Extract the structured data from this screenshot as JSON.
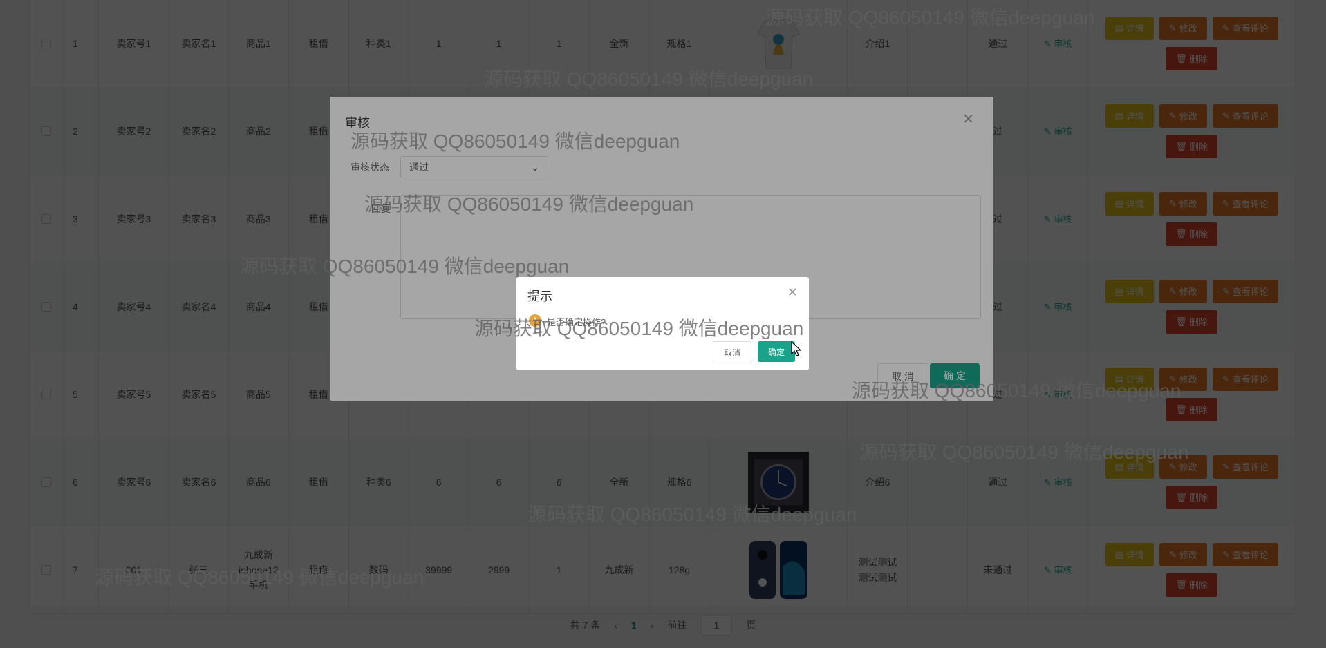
{
  "rows": [
    {
      "no": "1",
      "seller_no": "卖家号1",
      "seller_name": "卖家名1",
      "goods": "商品1",
      "mode": "租借",
      "category": "种类1",
      "c1": "1",
      "c2": "1",
      "c3": "1",
      "condition": "全新",
      "spec": "规格1",
      "intro": "介绍1",
      "status": "通过",
      "img": "tshirt"
    },
    {
      "no": "2",
      "seller_no": "卖家号2",
      "seller_name": "卖家名2",
      "goods": "商品2",
      "mode": "租借",
      "category": "",
      "c1": "",
      "c2": "",
      "c3": "",
      "condition": "",
      "spec": "",
      "intro": "",
      "status": "过",
      "img": ""
    },
    {
      "no": "3",
      "seller_no": "卖家号3",
      "seller_name": "卖家名3",
      "goods": "商品3",
      "mode": "租借",
      "category": "",
      "c1": "",
      "c2": "",
      "c3": "",
      "condition": "",
      "spec": "",
      "intro": "",
      "status": "过",
      "img": ""
    },
    {
      "no": "4",
      "seller_no": "卖家号4",
      "seller_name": "卖家名4",
      "goods": "商品4",
      "mode": "租借",
      "category": "",
      "c1": "",
      "c2": "",
      "c3": "",
      "condition": "",
      "spec": "",
      "intro": "",
      "status": "过",
      "img": ""
    },
    {
      "no": "5",
      "seller_no": "卖家号5",
      "seller_name": "卖家名5",
      "goods": "商品5",
      "mode": "租借",
      "category": "",
      "c1": "",
      "c2": "",
      "c3": "",
      "condition": "",
      "spec": "",
      "intro": "",
      "status": "过",
      "img": ""
    },
    {
      "no": "6",
      "seller_no": "卖家号6",
      "seller_name": "卖家名6",
      "goods": "商品6",
      "mode": "租借",
      "category": "种类6",
      "c1": "6",
      "c2": "6",
      "c3": "6",
      "condition": "全新",
      "spec": "规格6",
      "intro": "介绍6",
      "status": "通过",
      "img": "watch"
    },
    {
      "no": "7",
      "seller_no": "001",
      "seller_name": "张三",
      "goods": "九成新iphone12手机",
      "mode": "租借",
      "category": "数码",
      "c1": "39999",
      "c2": "2999",
      "c3": "1",
      "condition": "九成新",
      "spec": "128g",
      "intro": "测试测试测试测试",
      "status": "未通过",
      "img": "phones"
    }
  ],
  "actions": {
    "audit": "审核",
    "detail": "详情",
    "edit": "修改",
    "comments": "查看评论",
    "delete": "删除"
  },
  "pager": {
    "total": "共 7 条",
    "page": "1",
    "goto": "前往",
    "page_input": "1",
    "page_suffix": "页"
  },
  "audit_dialog": {
    "title": "审核",
    "status_label": "审核状态",
    "status_value": "通过",
    "reply_label": "回复",
    "cancel": "取 消",
    "ok": "确 定"
  },
  "confirm_dialog": {
    "title": "提示",
    "message": "是否确定操作?",
    "cancel": "取消",
    "ok": "确定"
  },
  "watermark": "源码获取 QQ86050149 微信deepguan",
  "colors": {
    "accent": "#1aa38a",
    "detail": "#e5c21b",
    "edit": "#e37726",
    "delete": "#d9452f"
  }
}
